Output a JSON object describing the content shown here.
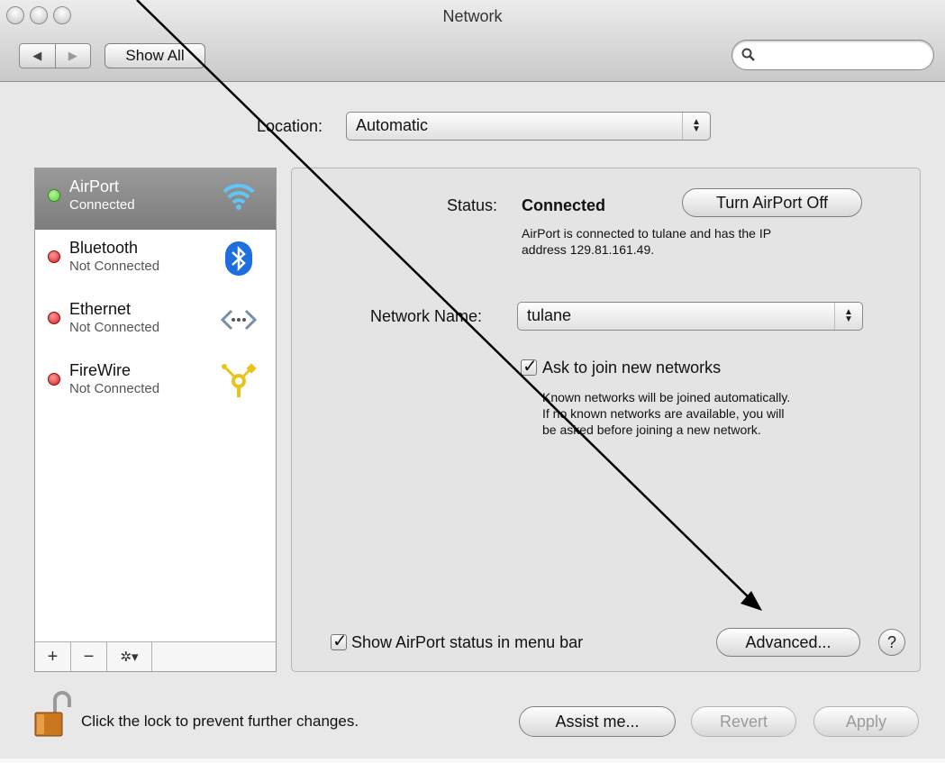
{
  "window": {
    "title": "Network",
    "show_all_label": "Show All",
    "nav_back_glyph": "◀",
    "nav_forward_glyph": "▶",
    "search_placeholder": ""
  },
  "location": {
    "label": "Location:",
    "value": "Automatic"
  },
  "services": [
    {
      "name": "AirPort",
      "status": "Connected",
      "status_color": "#5cd13a",
      "icon": "wifi-icon",
      "selected": true
    },
    {
      "name": "Bluetooth",
      "status": "Not Connected",
      "status_color": "#d92020",
      "icon": "bluetooth-icon",
      "selected": false
    },
    {
      "name": "Ethernet",
      "status": "Not Connected",
      "status_color": "#d92020",
      "icon": "ethernet-icon",
      "selected": false
    },
    {
      "name": "FireWire",
      "status": "Not Connected",
      "status_color": "#d92020",
      "icon": "firewire-icon",
      "selected": false
    }
  ],
  "sidebar_buttons": {
    "add": "+",
    "remove": "−",
    "action": "✲▾"
  },
  "detail": {
    "status_label": "Status:",
    "status_value": "Connected",
    "turn_off_label": "Turn AirPort Off",
    "status_desc_line1": "AirPort is connected to tulane and has the IP",
    "status_desc_line2": "address 129.81.161.49.",
    "network_name_label": "Network Name:",
    "network_name_value": "tulane",
    "ask_join_label": "Ask to join new networks",
    "ask_join_checked": true,
    "ask_desc_line1": "Known networks will be joined automatically.",
    "ask_desc_line2": "If no known networks are available, you will",
    "ask_desc_line3": "be asked before joining a new network.",
    "show_status_label": "Show AirPort status in menu bar",
    "show_status_checked": true,
    "advanced_label": "Advanced...",
    "help_label": "?"
  },
  "footer": {
    "lock_text": "Click the lock to prevent further changes.",
    "assist_label": "Assist me...",
    "revert_label": "Revert",
    "apply_label": "Apply"
  }
}
